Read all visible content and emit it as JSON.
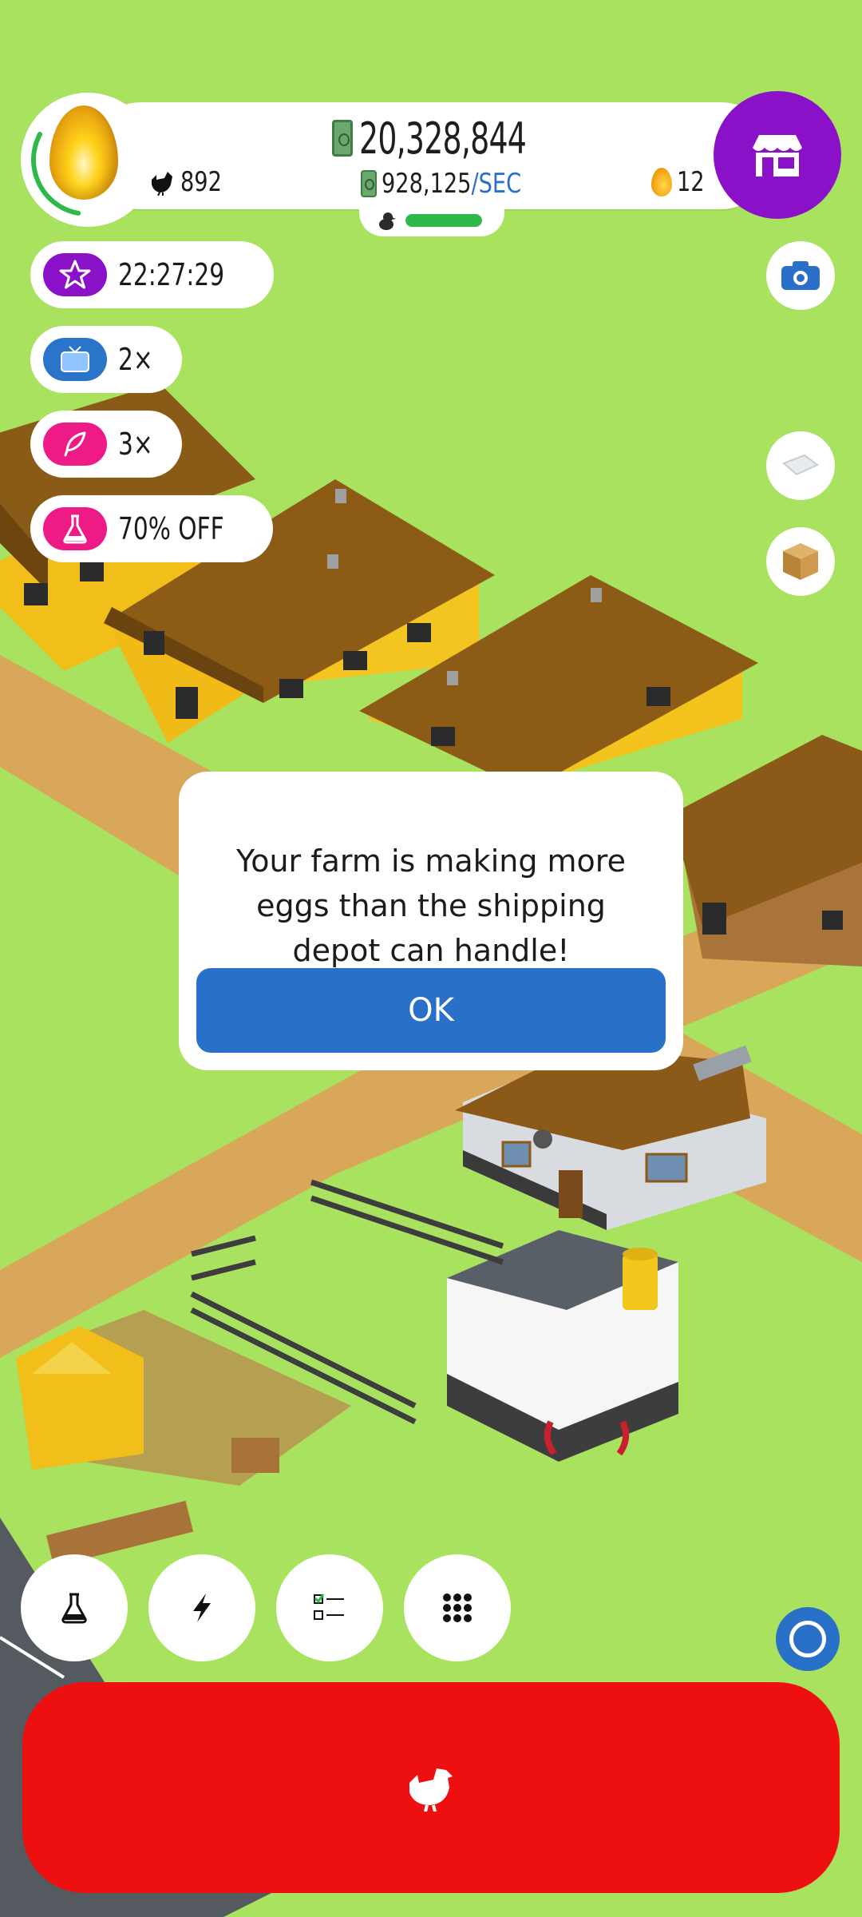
{
  "hud": {
    "money": "20,328,844",
    "income_rate_value": "928,125",
    "income_rate_unit": "/SEC",
    "chicken_count": "892",
    "golden_eggs": "12",
    "egg_progress": 0.3,
    "habitat_fill": 1.0
  },
  "boosts": [
    {
      "icon": "star-icon",
      "label": "22:27:29",
      "color": "#8a11c8"
    },
    {
      "icon": "tv-icon",
      "label": "2×",
      "color": "#2a74c9"
    },
    {
      "icon": "feather-icon",
      "label": "3×",
      "color": "#ee1a86"
    },
    {
      "icon": "flask-icon",
      "label": "70% OFF",
      "color": "#ee1a86"
    }
  ],
  "dialog": {
    "message": "Your farm is making more eggs than the shipping depot can handle!",
    "ok_label": "OK"
  },
  "toolbar": {
    "buttons": [
      "flask-icon",
      "lightning-icon",
      "checklist-icon",
      "grid-icon"
    ]
  },
  "colors": {
    "grass": "#a8e25f",
    "shop": "#8a11c8",
    "primary_blue": "#2970c9",
    "hatch_red": "#ee0f10"
  }
}
